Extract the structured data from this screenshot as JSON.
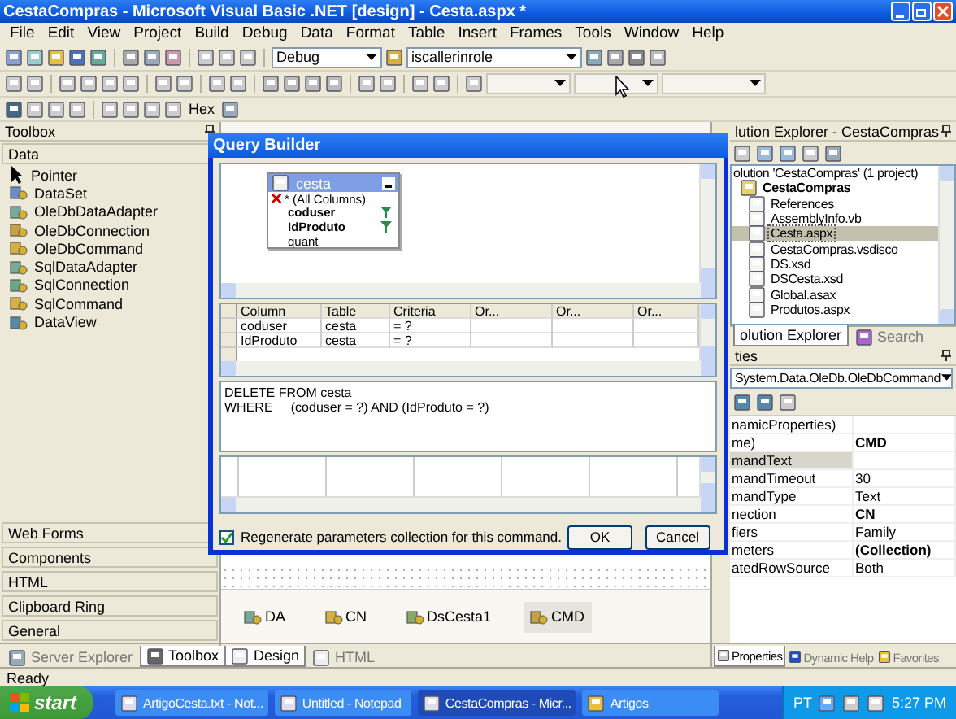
{
  "window": {
    "title": "CestaCompras - Microsoft Visual Basic .NET [design] - Cesta.aspx *"
  },
  "menu": [
    "File",
    "Edit",
    "View",
    "Project",
    "Build",
    "Debug",
    "Data",
    "Format",
    "Table",
    "Insert",
    "Frames",
    "Tools",
    "Window",
    "Help"
  ],
  "toolbar": {
    "configuration": "Debug",
    "find": "iscallerinrole",
    "hex_button": "Hex"
  },
  "toolbox": {
    "title": "Toolbox",
    "category": "Data",
    "items": [
      "Pointer",
      "DataSet",
      "OleDbDataAdapter",
      "OleDbConnection",
      "OleDbCommand",
      "SqlDataAdapter",
      "SqlConnection",
      "SqlCommand",
      "DataView"
    ],
    "categories": [
      "Web Forms",
      "Components",
      "HTML",
      "Clipboard Ring",
      "General"
    ],
    "tabs": [
      {
        "label": "Server Explorer",
        "selected": false
      },
      {
        "label": "Toolbox",
        "selected": true
      }
    ]
  },
  "dialog": {
    "title": "Query Builder",
    "table": {
      "name": "cesta",
      "columns": [
        {
          "label": "* (All Columns)",
          "kind": "all",
          "filtered": false
        },
        {
          "label": "coduser",
          "kind": "column",
          "filtered": true
        },
        {
          "label": "IdProduto",
          "kind": "column",
          "filtered": true
        },
        {
          "label": "quant",
          "kind": "column",
          "filtered": false
        }
      ]
    },
    "grid": {
      "columns": [
        "Column",
        "Table",
        "Criteria",
        "Or...",
        "Or...",
        "Or..."
      ],
      "rows": [
        [
          "coduser",
          "cesta",
          "= ?"
        ],
        [
          "IdProduto",
          "cesta",
          "= ?"
        ]
      ]
    },
    "sql": [
      "DELETE FROM cesta",
      "WHERE     (coduser = ?) AND (IdProduto = ?)"
    ],
    "regenerate": {
      "label": "Regenerate parameters collection for this command.",
      "checked": true
    },
    "buttons": [
      "OK",
      "Cancel"
    ]
  },
  "designer": {
    "components": [
      {
        "label": "DA",
        "selected": false
      },
      {
        "label": "CN",
        "selected": false
      },
      {
        "label": "DsCesta1",
        "selected": false
      },
      {
        "label": "CMD",
        "selected": true
      }
    ],
    "tabs": [
      {
        "label": "Design",
        "selected": true
      },
      {
        "label": "HTML",
        "selected": false
      }
    ]
  },
  "solution_explorer": {
    "title": "lution Explorer - CestaCompras",
    "tree": [
      {
        "label": "olution 'CestaCompras' (1 project)",
        "selected": false,
        "children": [
          {
            "label": "CestaCompras",
            "selected": false,
            "children": [
              {
                "label": "References",
                "selected": false
              },
              {
                "label": "AssemblyInfo.vb",
                "selected": false
              },
              {
                "label": "Cesta.aspx",
                "selected": true
              },
              {
                "label": "CestaCompras.vsdisco",
                "selected": false
              },
              {
                "label": "DS.xsd",
                "selected": false
              },
              {
                "label": "DSCesta.xsd",
                "selected": false
              },
              {
                "label": "Global.asax",
                "selected": false
              },
              {
                "label": "Produtos.aspx",
                "selected": false
              }
            ]
          }
        ]
      }
    ],
    "tabs": [
      {
        "label": "olution Explorer",
        "selected": true
      },
      {
        "label": "Search",
        "selected": false
      }
    ]
  },
  "properties": {
    "title": "ties",
    "object": "System.Data.OleDb.OleDbCommand",
    "rows": [
      {
        "name": "namicProperties)",
        "value": "",
        "selected": false
      },
      {
        "name": "me)",
        "value": "CMD",
        "bold": true,
        "selected": false
      },
      {
        "name": "mandText",
        "value": "",
        "selected": true
      },
      {
        "name": "mandTimeout",
        "value": "30",
        "bold": false,
        "selected": false
      },
      {
        "name": "mandType",
        "value": "Text",
        "bold": false,
        "selected": false
      },
      {
        "name": "nection",
        "value": "CN",
        "bold": true,
        "selected": false
      },
      {
        "name": "fiers",
        "value": "Family",
        "bold": false,
        "selected": false
      },
      {
        "name": "meters",
        "value": "(Collection)",
        "bold": true,
        "selected": false
      },
      {
        "name": "atedRowSource",
        "value": "Both",
        "bold": false,
        "selected": false
      }
    ],
    "tabs": [
      {
        "label": "Properties",
        "selected": true
      },
      {
        "label": "Dynamic Help",
        "selected": false
      },
      {
        "label": "Favorites",
        "selected": false
      }
    ]
  },
  "status_bar": {
    "text": "Ready"
  },
  "taskbar": {
    "start": "start",
    "tasks": [
      {
        "label": "ArtigoCesta.txt - Not...",
        "selected": false
      },
      {
        "label": "Untitled - Notepad",
        "selected": false
      },
      {
        "label": "CestaCompras - Micr...",
        "selected": true
      },
      {
        "label": "Artigos",
        "selected": false
      }
    ],
    "language": "PT",
    "clock": "5:27 PM"
  }
}
